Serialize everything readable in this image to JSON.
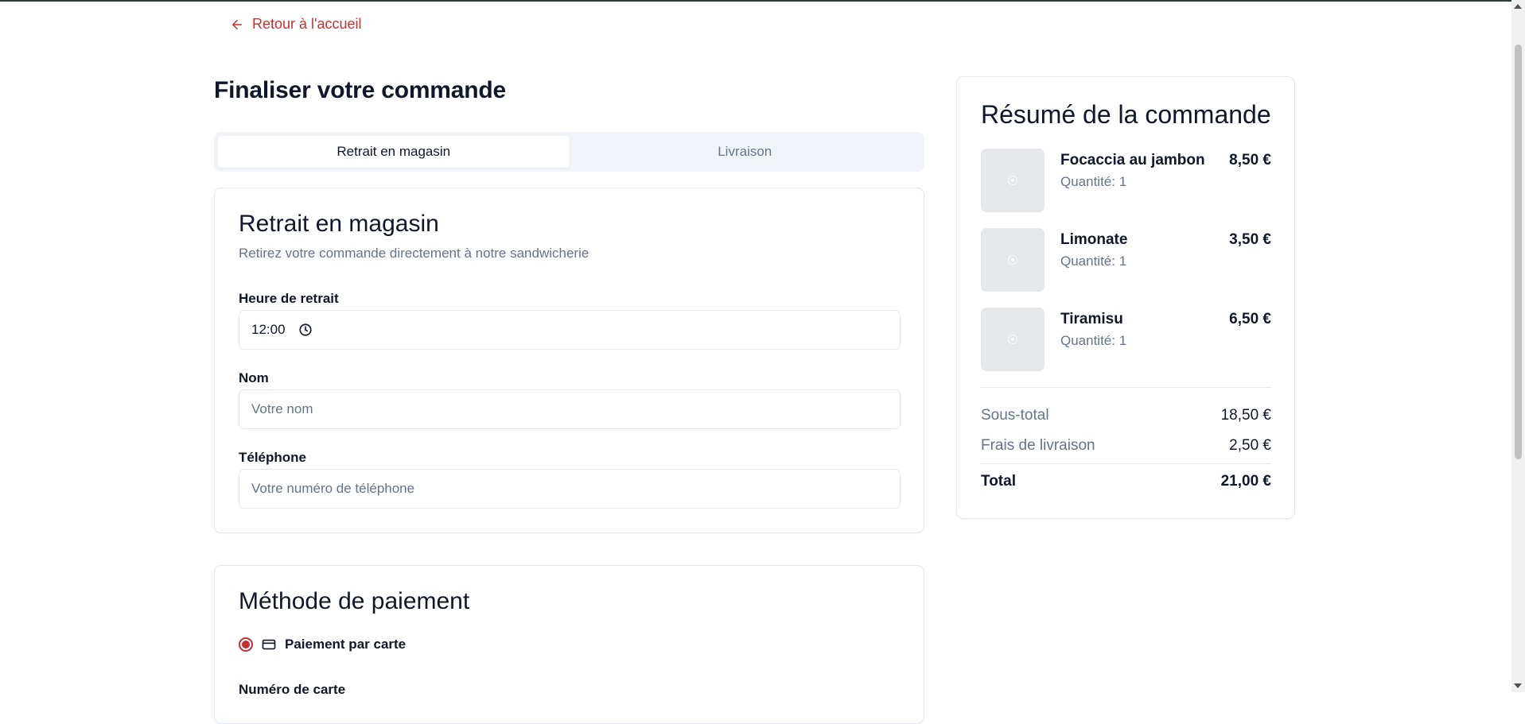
{
  "nav": {
    "back_label": "Retour à l'accueil"
  },
  "page": {
    "title": "Finaliser votre commande"
  },
  "tabs": [
    {
      "label": "Retrait en magasin",
      "active": true
    },
    {
      "label": "Livraison",
      "active": false
    }
  ],
  "pickup": {
    "title": "Retrait en magasin",
    "description": "Retirez votre commande directement à notre sandwicherie",
    "time_label": "Heure de retrait",
    "time_value": "12:00",
    "name_label": "Nom",
    "name_placeholder": "Votre nom",
    "phone_label": "Téléphone",
    "phone_placeholder": "Votre numéro de téléphone"
  },
  "payment": {
    "title": "Méthode de paiement",
    "option_label": "Paiement par carte",
    "card_number_label": "Numéro de carte"
  },
  "summary": {
    "title": "Résumé de la commande",
    "items": [
      {
        "name": "Focaccia au jambon",
        "quantity": "Quantité: 1",
        "price": "8,50 €"
      },
      {
        "name": "Limonate",
        "quantity": "Quantité: 1",
        "price": "3,50 €"
      },
      {
        "name": "Tiramisu",
        "quantity": "Quantité: 1",
        "price": "6,50 €"
      }
    ],
    "subtotal_label": "Sous-total",
    "subtotal_value": "18,50 €",
    "delivery_label": "Frais de livraison",
    "delivery_value": "2,50 €",
    "total_label": "Total",
    "total_value": "21,00 €"
  },
  "colors": {
    "accent": "#c53030",
    "muted": "#64748b",
    "border": "#e2e8f0",
    "tab_bg": "#f1f5f9"
  }
}
